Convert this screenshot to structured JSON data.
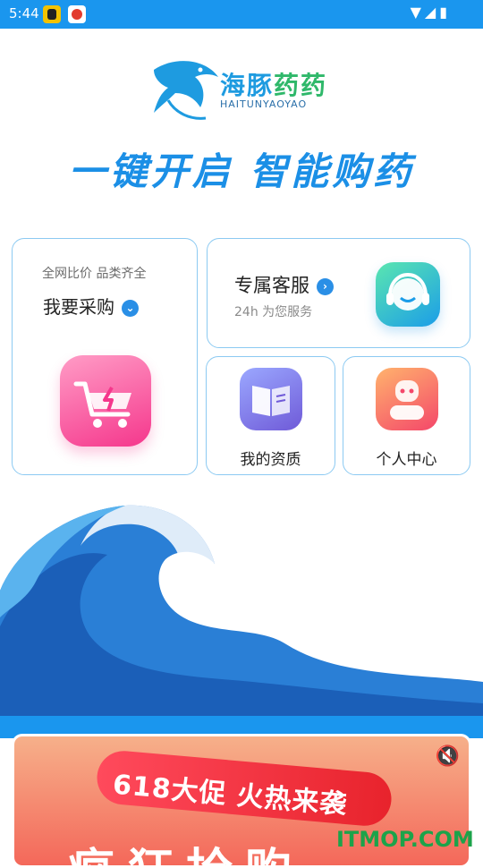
{
  "status_bar": {
    "time": "5:44",
    "system_icons": "▼◢▮"
  },
  "brand": {
    "name_blue": "海豚",
    "name_green": "药药",
    "name_en": "HAITUNYAOYAO"
  },
  "slogan": "一键开启   智能购药",
  "cards": {
    "buy": {
      "subtitle": "全网比价 品类齐全",
      "title": "我要采购",
      "icon": "cart-icon"
    },
    "service": {
      "title": "专属客服",
      "subtitle": "24h 为您服务",
      "icon": "customer-service-icon"
    },
    "qualification": {
      "title": "我的资质",
      "icon": "book-icon"
    },
    "user_center": {
      "title": "个人中心",
      "icon": "user-icon"
    }
  },
  "banner": {
    "headline": "618大促 火热来袭",
    "big_text": "疯狂抢购"
  },
  "watermark": "ITMOP.COM",
  "colors": {
    "accent": "#1a96ee",
    "card_border": "#8ccaf2",
    "pink": "#f5378c"
  }
}
